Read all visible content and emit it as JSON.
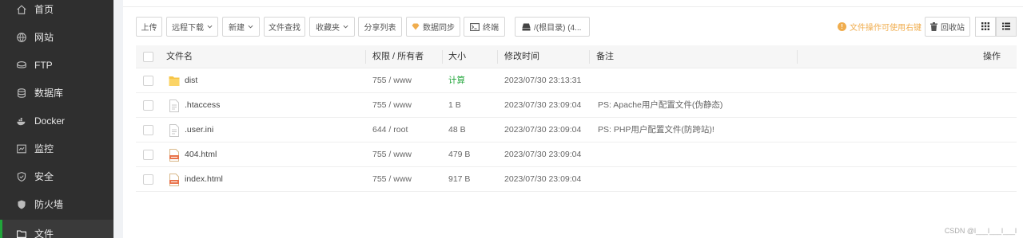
{
  "sidebar": {
    "items": [
      {
        "label": "首页",
        "icon": "home-icon"
      },
      {
        "label": "网站",
        "icon": "globe-icon"
      },
      {
        "label": "FTP",
        "icon": "ftp-icon"
      },
      {
        "label": "数据库",
        "icon": "database-icon"
      },
      {
        "label": "Docker",
        "icon": "docker-icon"
      },
      {
        "label": "监控",
        "icon": "monitor-icon"
      },
      {
        "label": "安全",
        "icon": "shield-icon"
      },
      {
        "label": "防火墙",
        "icon": "firewall-icon"
      },
      {
        "label": "文件",
        "icon": "folder-icon",
        "active": true
      }
    ]
  },
  "toolbar": {
    "upload": "上传",
    "remote_download": "远程下载",
    "new": "新建",
    "file_search": "文件查找",
    "favorites": "收藏夹",
    "share_list": "分享列表",
    "data_sync": "数据同步",
    "terminal": "终端",
    "path": "/(根目录) (4...",
    "tip": "文件操作可使用右键",
    "recycle_bin": "回收站"
  },
  "table": {
    "headers": {
      "name": "文件名",
      "perm": "权限 / 所有者",
      "size": "大小",
      "mtime": "修改时间",
      "note": "备注",
      "action": "操作"
    },
    "rows": [
      {
        "name": "dist",
        "type": "folder",
        "perm": "755 / www",
        "size": "计算",
        "mtime": "2023/07/30 23:13:31",
        "note": ""
      },
      {
        "name": ".htaccess",
        "type": "file",
        "perm": "755 / www",
        "size": "1 B",
        "mtime": "2023/07/30 23:09:04",
        "note": "PS: Apache用户配置文件(伪静态)"
      },
      {
        "name": ".user.ini",
        "type": "file",
        "perm": "644 / root",
        "size": "48 B",
        "mtime": "2023/07/30 23:09:04",
        "note": "PS: PHP用户配置文件(防跨站)!"
      },
      {
        "name": "404.html",
        "type": "html",
        "perm": "755 / www",
        "size": "479 B",
        "mtime": "2023/07/30 23:09:04",
        "note": ""
      },
      {
        "name": "index.html",
        "type": "html",
        "perm": "755 / www",
        "size": "917 B",
        "mtime": "2023/07/30 23:09:04",
        "note": ""
      }
    ]
  },
  "watermark": "CSDN @l___l___l___l",
  "colors": {
    "accent": "#20a53a",
    "warning": "#f0ad4e",
    "sidebar_bg": "#2f2f2f"
  }
}
